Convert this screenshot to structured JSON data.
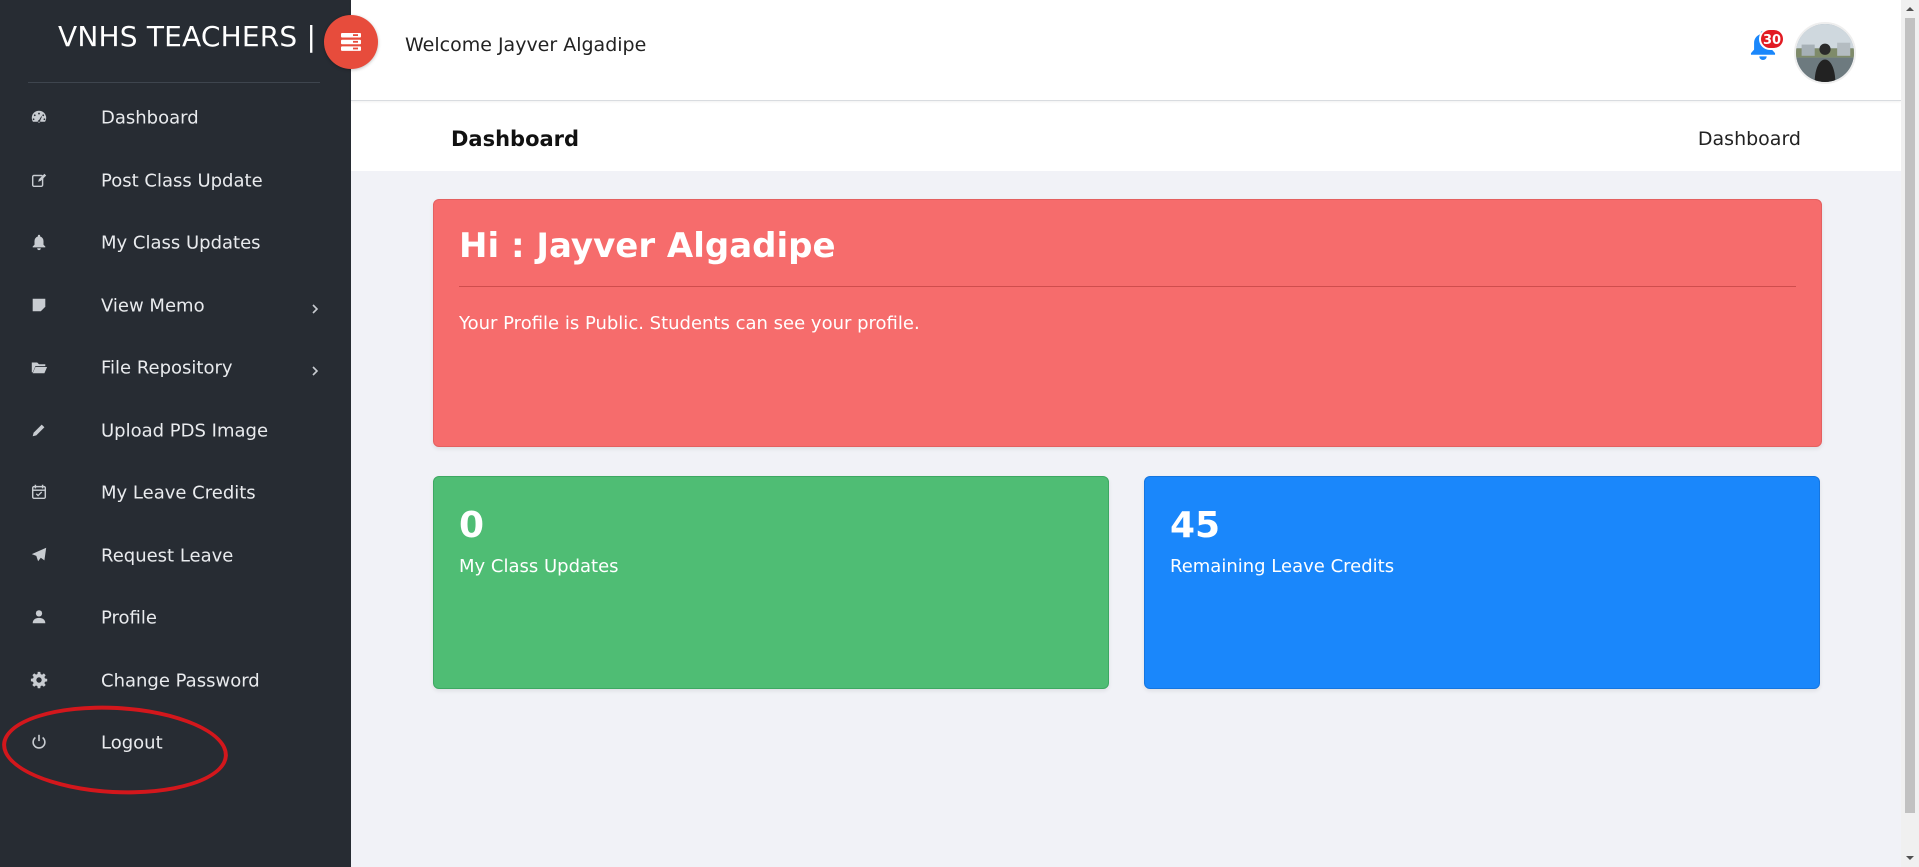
{
  "brand": {
    "title": "VNHS TEACHERS |"
  },
  "header": {
    "welcome": "Welcome Jayver Algadipe",
    "notification_count": "30",
    "avatar_icon": "user-avatar-photo"
  },
  "sidebar": {
    "items": [
      {
        "label": "Dashboard",
        "icon": "dashboard-icon"
      },
      {
        "label": "Post Class Update",
        "icon": "edit-icon"
      },
      {
        "label": "My Class Updates",
        "icon": "bell-icon"
      },
      {
        "label": "View Memo",
        "icon": "sticky-note-icon",
        "has_submenu": true
      },
      {
        "label": "File Repository",
        "icon": "folder-open-icon",
        "has_submenu": true
      },
      {
        "label": "Upload PDS Image",
        "icon": "pencil-icon"
      },
      {
        "label": "My Leave Credits",
        "icon": "calendar-check-icon"
      },
      {
        "label": "Request Leave",
        "icon": "paper-plane-icon"
      },
      {
        "label": "Profile",
        "icon": "user-icon"
      },
      {
        "label": "Change Password",
        "icon": "gear-icon"
      },
      {
        "label": "Logout",
        "icon": "power-icon"
      }
    ]
  },
  "breadcrumb": {
    "title": "Dashboard",
    "link": "Dashboard"
  },
  "main": {
    "greeting": "Hi : Jayver Algadipe",
    "profile_message": "Your Profile is Public. Students can see your profile.",
    "stats": [
      {
        "value": "0",
        "label": "My Class Updates"
      },
      {
        "value": "45",
        "label": "Remaining Leave Credits"
      }
    ]
  },
  "colors": {
    "sidebar_bg": "#272c33",
    "toggle_button": "#e74c3c",
    "greeting_card": "#f66c6c",
    "class_updates_card": "#4fbd74",
    "leave_credits_card": "#1a87fb",
    "notification_badge": "#e21b23",
    "annotation_circle": "#d3171c"
  }
}
